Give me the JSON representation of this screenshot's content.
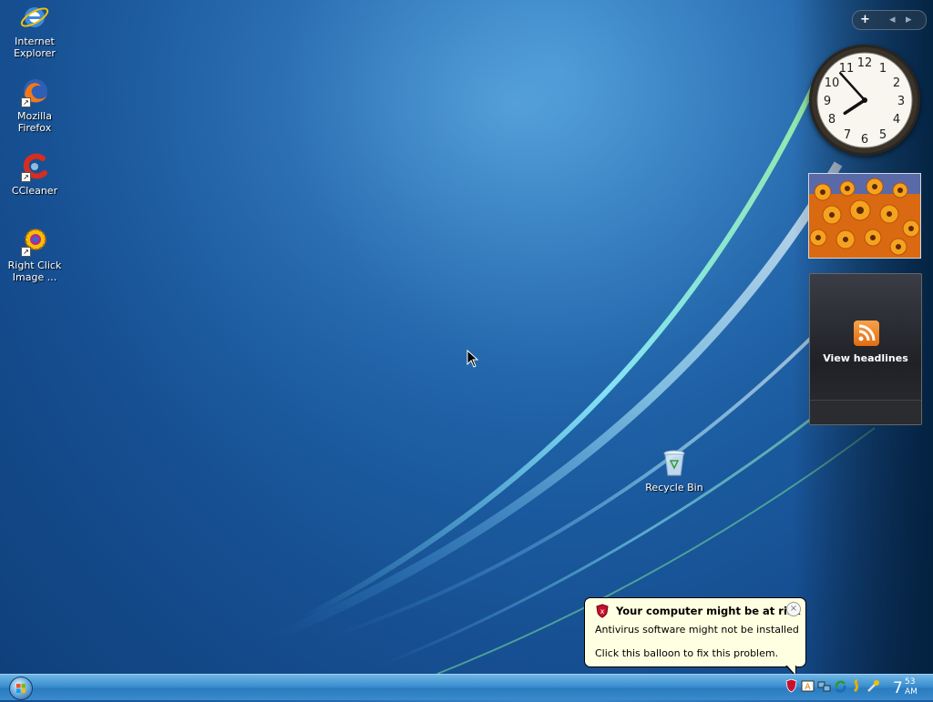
{
  "desktop": {
    "icons": [
      {
        "label_line1": "Internet",
        "label_line2": "Explorer",
        "icon": "internet-explorer-icon"
      },
      {
        "label_line1": "Mozilla Firefox",
        "label_line2": "",
        "icon": "firefox-icon"
      },
      {
        "label_line1": "CCleaner",
        "label_line2": "",
        "icon": "ccleaner-icon"
      },
      {
        "label_line1": "Right Click",
        "label_line2": "Image ...",
        "icon": "right-click-image-icon"
      },
      {
        "label_line1": "Recycle Bin",
        "label_line2": "",
        "icon": "recycle-bin-icon"
      }
    ]
  },
  "sidebar": {
    "add_gadget_symbol": "+",
    "prev_symbol": "◂",
    "next_symbol": "▸",
    "clock": {
      "hour": 7,
      "minute": 53
    },
    "feed_text": "View headlines"
  },
  "balloon": {
    "title": "Your computer might be at risk",
    "line1": "Antivirus software might not be installed",
    "line2": "Click this balloon to fix this problem.",
    "close_symbol": "×"
  },
  "taskbar": {
    "clock_hour": "7",
    "clock_minutes": "53",
    "clock_ampm": "AM"
  },
  "colors": {
    "balloon_bg": "#ffffe1",
    "taskbar_blue": "#3b8fcf"
  }
}
